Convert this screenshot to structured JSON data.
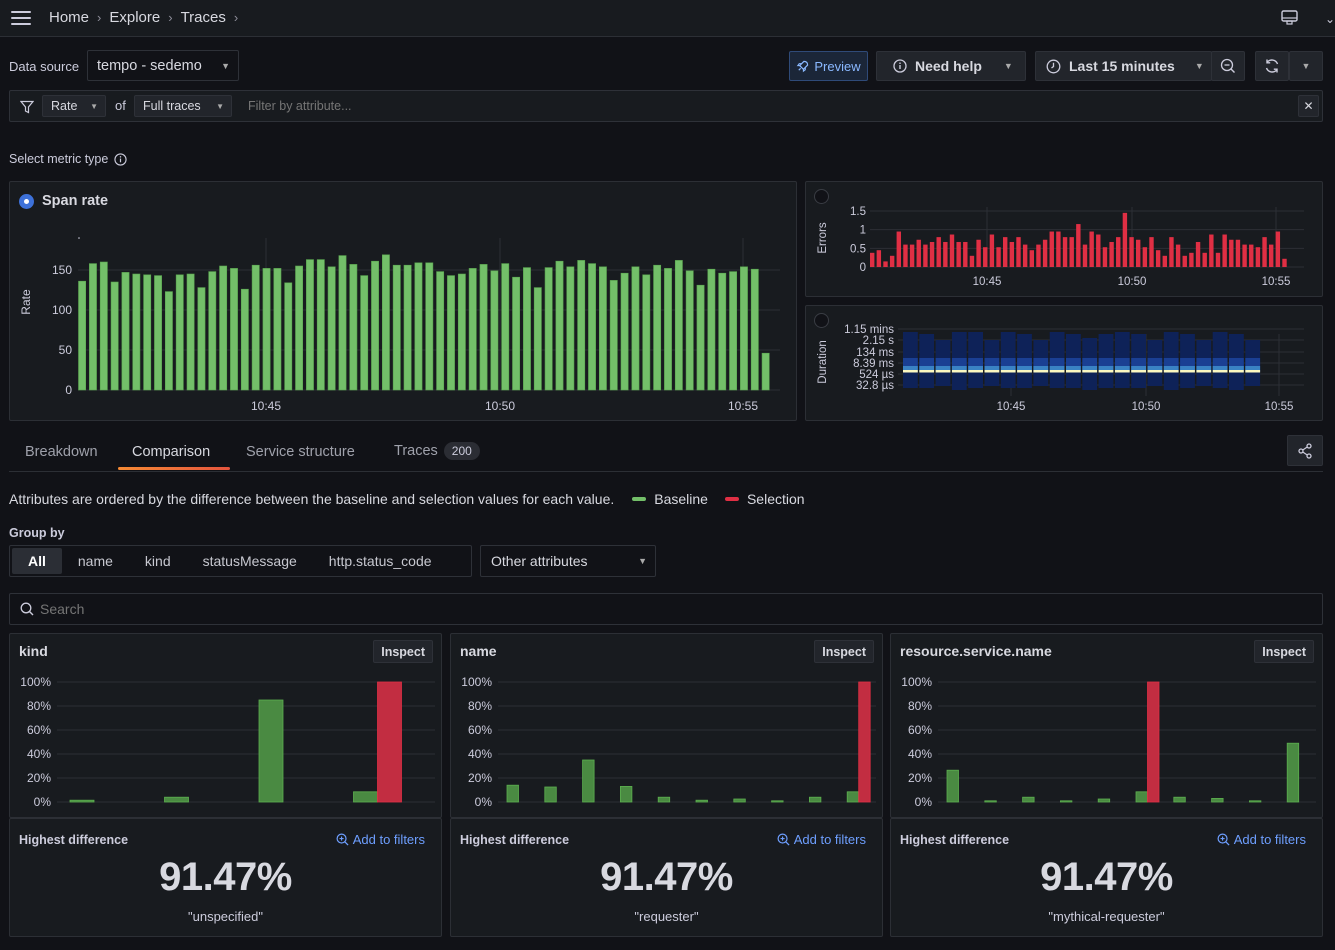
{
  "topbar": {
    "breadcrumb": [
      "Home",
      "Explore",
      "Traces"
    ]
  },
  "controls": {
    "data_source_label": "Data source",
    "data_source_value": "tempo - sedemo",
    "preview_label": "Preview",
    "need_help_label": "Need help",
    "time_range_label": "Last 15 minutes"
  },
  "filter": {
    "metric_value": "Rate",
    "of_label": "of",
    "scope_value": "Full traces",
    "placeholder": "Filter by attribute..."
  },
  "metric_type": {
    "label": "Select metric type"
  },
  "colors": {
    "baseline": "#73bf69",
    "selection": "#e02f44",
    "errors": "#e02f44",
    "accent": "#3d71d9",
    "link": "#6e9fff"
  },
  "chart_data": [
    {
      "id": "span-rate",
      "type": "bar",
      "title": "Span rate",
      "selected": true,
      "ylabel": "Rate",
      "xlabel": "",
      "ylim": [
        0,
        190
      ],
      "yticks": [
        0,
        50,
        100,
        150
      ],
      "xticks": [
        "10:45",
        "10:50",
        "10:55"
      ],
      "values": [
        136,
        158,
        160,
        135,
        147,
        145,
        144,
        143,
        123,
        144,
        145,
        128,
        148,
        155,
        152,
        126,
        156,
        152,
        152,
        134,
        155,
        163,
        163,
        154,
        168,
        157,
        143,
        161,
        169,
        156,
        156,
        159,
        159,
        148,
        143,
        145,
        152,
        157,
        149,
        158,
        141,
        153,
        128,
        153,
        161,
        154,
        162,
        158,
        154,
        137,
        146,
        154,
        144,
        156,
        152,
        162,
        149,
        131,
        151,
        146,
        148,
        154,
        151,
        46
      ]
    },
    {
      "id": "errors",
      "type": "bar",
      "title": "",
      "selected": false,
      "ylabel": "Errors",
      "ylim": [
        0,
        1.6
      ],
      "yticks": [
        "0",
        "0.5",
        "1",
        "1.5"
      ],
      "xticks": [
        "10:45",
        "10:50",
        "10:55"
      ],
      "values": [
        0.38,
        0.45,
        0.15,
        0.3,
        0.95,
        0.6,
        0.6,
        0.73,
        0.6,
        0.67,
        0.8,
        0.67,
        0.87,
        0.67,
        0.67,
        0.3,
        0.73,
        0.53,
        0.87,
        0.53,
        0.8,
        0.67,
        0.8,
        0.6,
        0.45,
        0.6,
        0.73,
        0.95,
        0.95,
        0.8,
        0.8,
        1.15,
        0.6,
        0.95,
        0.87,
        0.53,
        0.67,
        0.8,
        1.45,
        0.8,
        0.73,
        0.53,
        0.8,
        0.45,
        0.3,
        0.8,
        0.6,
        0.3,
        0.38,
        0.67,
        0.38,
        0.87,
        0.38,
        0.87,
        0.73,
        0.73,
        0.6,
        0.6,
        0.53,
        0.8,
        0.6,
        0.95,
        0.22
      ]
    },
    {
      "id": "duration",
      "type": "heatmap",
      "title": "",
      "selected": false,
      "ylabel": "Duration",
      "yticks": [
        "32.8 µs",
        "524 µs",
        "8.39 ms",
        "134 ms",
        "2.15 s",
        "1.15 mins"
      ],
      "xticks": [
        "10:45",
        "10:50",
        "10:55"
      ],
      "columns": 22,
      "hot_band": "between 524 µs and 8.39 ms"
    },
    {
      "id": "kind",
      "type": "bar",
      "title": "kind",
      "ylim": [
        0,
        100
      ],
      "yticks": [
        "0%",
        "20%",
        "40%",
        "60%",
        "80%",
        "100%"
      ],
      "series": [
        {
          "name": "Baseline",
          "values": [
            1.5,
            4,
            85,
            8.5
          ]
        },
        {
          "name": "Selection",
          "values": [
            0,
            0,
            0,
            100
          ]
        }
      ]
    },
    {
      "id": "name",
      "type": "bar",
      "title": "name",
      "ylim": [
        0,
        100
      ],
      "yticks": [
        "0%",
        "20%",
        "40%",
        "60%",
        "80%",
        "100%"
      ],
      "series": [
        {
          "name": "Baseline",
          "values": [
            14,
            12.5,
            35,
            13,
            4,
            1.5,
            2.5,
            1,
            4,
            8.5
          ]
        },
        {
          "name": "Selection",
          "values": [
            0,
            0,
            0,
            0,
            0,
            0,
            0,
            0,
            0,
            100
          ]
        }
      ]
    },
    {
      "id": "resource-service-name",
      "type": "bar",
      "title": "resource.service.name",
      "ylim": [
        0,
        100
      ],
      "yticks": [
        "0%",
        "20%",
        "40%",
        "60%",
        "80%",
        "100%"
      ],
      "series": [
        {
          "name": "Baseline",
          "values": [
            26.5,
            1,
            4,
            1,
            2.5,
            8.5,
            4,
            3,
            1,
            49
          ]
        },
        {
          "name": "Selection",
          "values": [
            0,
            0,
            0,
            0,
            0,
            100,
            0,
            0,
            0,
            0
          ]
        }
      ]
    }
  ],
  "tabs": [
    {
      "label": "Breakdown",
      "active": false
    },
    {
      "label": "Comparison",
      "active": true
    },
    {
      "label": "Service structure",
      "active": false
    },
    {
      "label": "Traces",
      "active": false,
      "badge": "200"
    }
  ],
  "comparison": {
    "description": "Attributes are ordered by the difference between the baseline and selection values for each value.",
    "legend": [
      "Baseline",
      "Selection"
    ],
    "group_by_label": "Group by",
    "group_by_options": [
      "All",
      "name",
      "kind",
      "statusMessage",
      "http.status_code"
    ],
    "group_by_selected": "All",
    "other_attributes_label": "Other attributes",
    "search_placeholder": "Search",
    "cards": [
      {
        "title": "kind",
        "inspect_label": "Inspect",
        "hd_label": "Highest difference",
        "add_label": "Add to filters",
        "value": "91.47%",
        "value_label": "\"unspecified\""
      },
      {
        "title": "name",
        "inspect_label": "Inspect",
        "hd_label": "Highest difference",
        "add_label": "Add to filters",
        "value": "91.47%",
        "value_label": "\"requester\""
      },
      {
        "title": "resource.service.name",
        "inspect_label": "Inspect",
        "hd_label": "Highest difference",
        "add_label": "Add to filters",
        "value": "91.47%",
        "value_label": "\"mythical-requester\""
      }
    ]
  }
}
